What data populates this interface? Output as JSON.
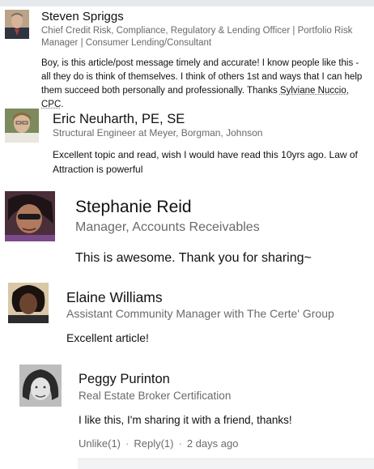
{
  "comments": [
    {
      "name": "Steven Spriggs",
      "headline": "Chief Credit Risk, Compliance, Regulatory & Lending Officer | Portfolio Risk Manager | Consumer Lending/Consultant",
      "body": "Boy, is this article/post message timely and accurate! I know people like this - all they do is think of themselves. I think of others 1st and ways that I can help them succeed both personally and professionally. Thanks ",
      "mention": "Sylviane Nuccio, CPC",
      "body_end": "."
    },
    {
      "name": "Eric Neuharth, PE, SE",
      "headline": "Structural Engineer at Meyer, Borgman, Johnson",
      "body": "Excellent topic and read, wish I would have read this 10yrs ago. Law of Attraction is powerful"
    },
    {
      "name": "Stephanie Reid",
      "headline": "Manager, Accounts Receivables",
      "body": "This is awesome. Thank you for sharing~"
    },
    {
      "name": "Elaine Williams",
      "headline": "Assistant Community Manager with The Certe' Group",
      "body": "Excellent article!"
    },
    {
      "name": "Peggy Purinton",
      "headline": "Real Estate Broker Certification",
      "body": "I like this, I'm sharing it with a friend, thanks!",
      "actions": {
        "unlike": "Unlike(1)",
        "reply": "Reply(1)",
        "time": "2 days ago",
        "separator": "·"
      }
    }
  ]
}
